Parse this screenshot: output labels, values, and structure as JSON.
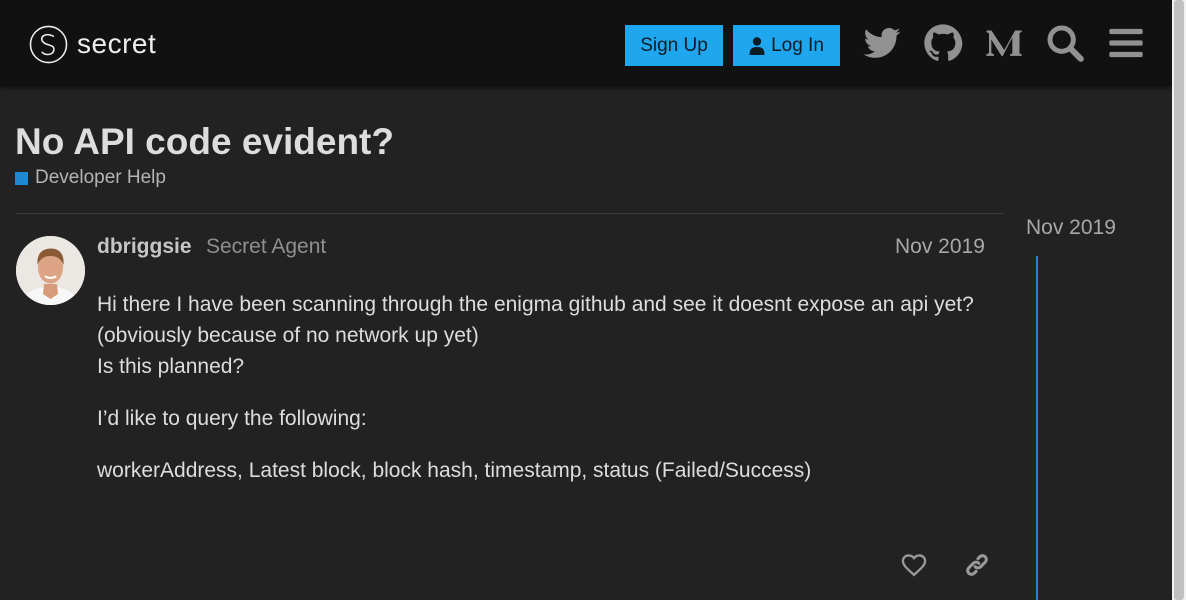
{
  "brand": {
    "name": "secret",
    "logo_icon": "secret-logo-icon"
  },
  "header": {
    "signup_label": "Sign Up",
    "login_label": "Log In",
    "icons": [
      "twitter-icon",
      "github-icon",
      "medium-icon",
      "search-icon",
      "hamburger-menu-icon"
    ]
  },
  "topic": {
    "title": "No API code evident?",
    "category": "Developer Help",
    "category_color": "#1e88d2"
  },
  "post": {
    "username": "dbriggsie",
    "user_title": "Secret Agent",
    "date": "Nov 2019",
    "paragraphs": [
      "Hi there I have been scanning through the enigma github and see it doesnt expose an api yet? (obviously because of no network up yet)",
      "Is this planned?",
      "I’d like to query the following:",
      "workerAddress, Latest block, block hash, timestamp, status (Failed/Success)"
    ]
  },
  "timeline": {
    "date": "Nov 2019"
  },
  "colors": {
    "accent": "#1ea7ef",
    "header_bg": "#111111",
    "page_bg": "#222222"
  }
}
